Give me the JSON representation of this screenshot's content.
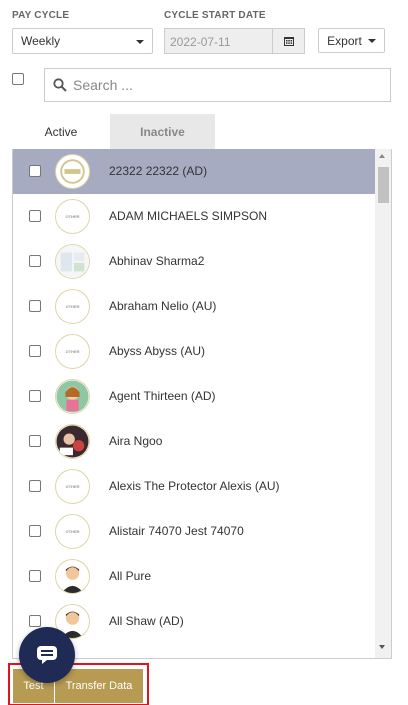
{
  "filters": {
    "pay_cycle_label": "PAY CYCLE",
    "pay_cycle_value": "Weekly",
    "cycle_start_label": "CYCLE START DATE",
    "cycle_start_value": "2022-07-11",
    "export_label": "Export"
  },
  "search": {
    "placeholder": "Search ..."
  },
  "tabs": {
    "active": "Active",
    "inactive": "Inactive"
  },
  "employees": [
    {
      "name": "22322 22322 (AD)",
      "avatar": "logo-badge-avatar",
      "selected": true
    },
    {
      "name": "ADAM MICHAELS SIMPSON",
      "avatar": "other-avatar",
      "avatar_text": "OTHER"
    },
    {
      "name": "Abhinav Sharma2",
      "avatar": "screenshot-avatar"
    },
    {
      "name": "Abraham Nelio (AU)",
      "avatar": "other-avatar",
      "avatar_text": "OTHER"
    },
    {
      "name": "Abyss Abyss (AU)",
      "avatar": "other-avatar",
      "avatar_text": "OTHER"
    },
    {
      "name": "Agent Thirteen (AD)",
      "avatar": "cartoon-girl-avatar"
    },
    {
      "name": "Aira Ngoo",
      "avatar": "photo-avatar"
    },
    {
      "name": "Alexis The Protector Alexis (AU)",
      "avatar": "other-avatar",
      "avatar_text": "OTHER"
    },
    {
      "name": "Alistair 74070 Jest 74070",
      "avatar": "other-avatar",
      "avatar_text": "OTHER"
    },
    {
      "name": "All Pure",
      "avatar": "person-avatar"
    },
    {
      "name": "All Shaw (AD)",
      "avatar": "person-avatar"
    }
  ],
  "actions": {
    "test_label": "Test",
    "transfer_label": "Transfer Data"
  },
  "colors": {
    "selected_row": "#a7abc1",
    "gold": "#b89b52",
    "fab": "#1f2a55",
    "highlight": "#e0141f"
  }
}
